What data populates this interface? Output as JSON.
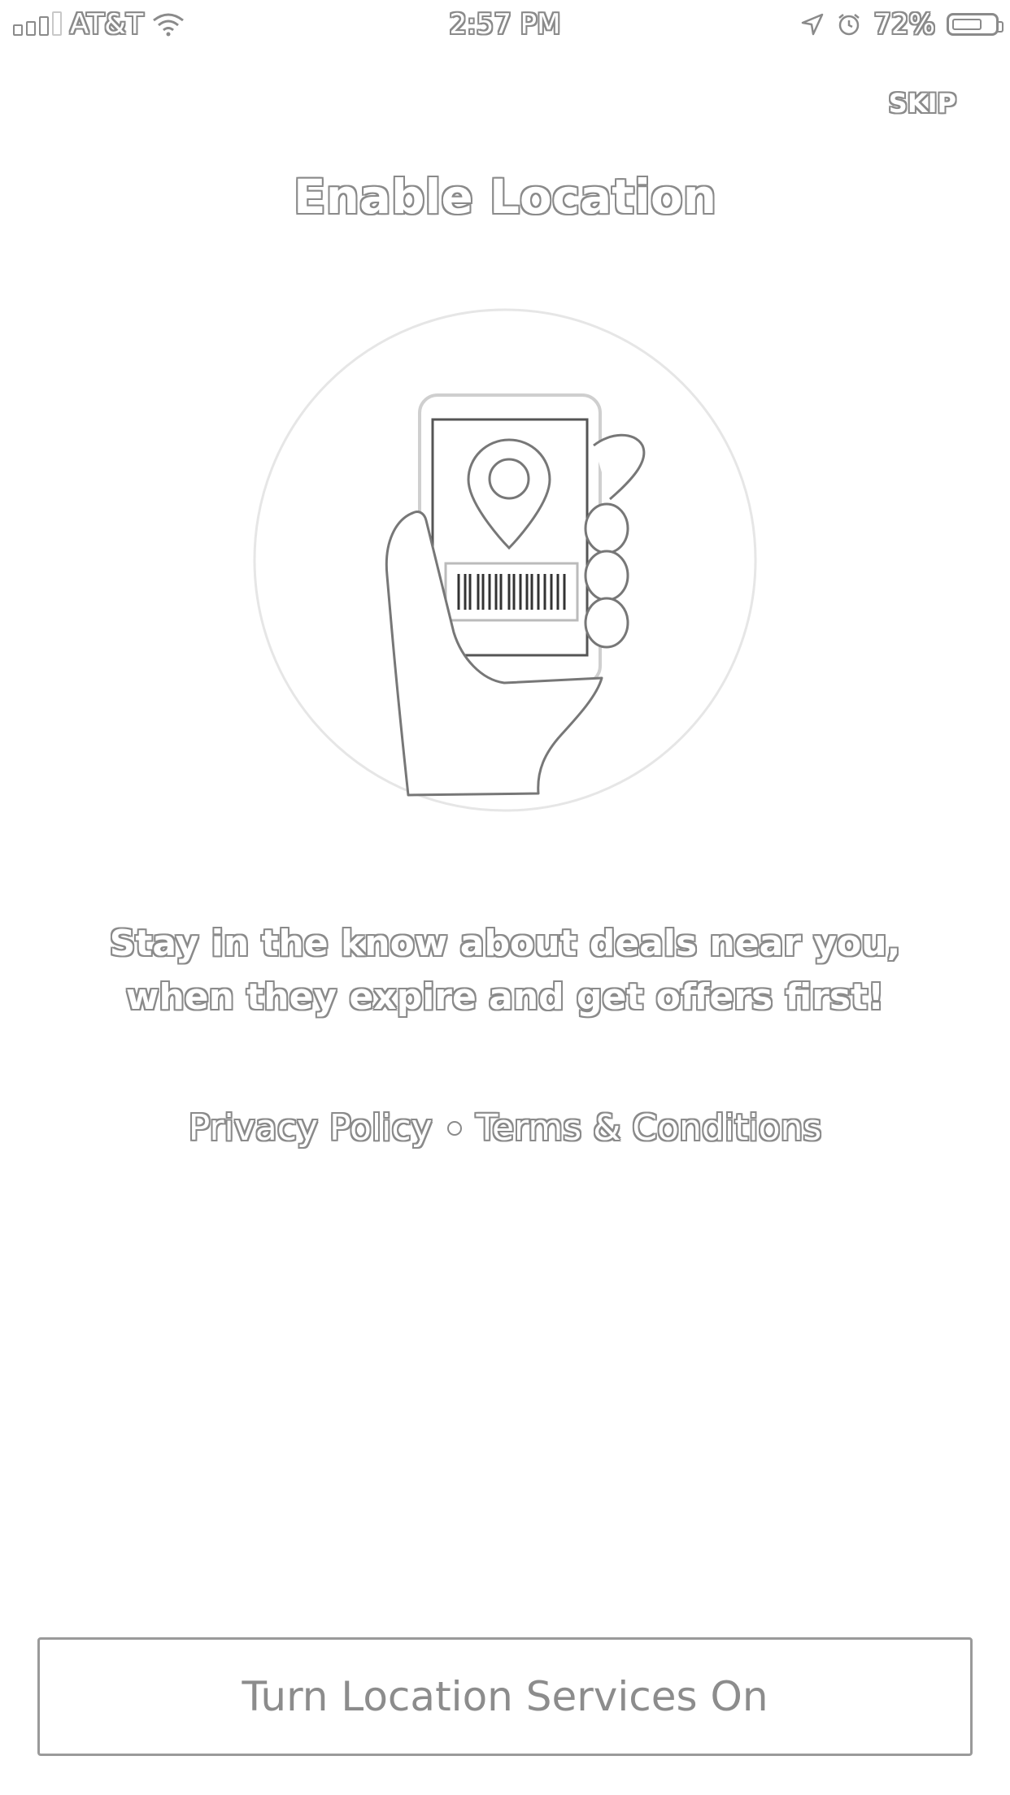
{
  "status_bar": {
    "carrier": "AT&T",
    "time": "2:57 PM",
    "battery_percent": "72%",
    "battery_level": 0.72,
    "icons": [
      "signal-icon",
      "wifi-icon",
      "location-arrow-icon",
      "alarm-icon",
      "battery-icon"
    ]
  },
  "header": {
    "skip_label": "SKIP"
  },
  "main": {
    "title": "Enable Location",
    "illustration": "hand-holding-phone-with-location-pin-and-barcode",
    "description": "Stay in the know about deals near you, when they expire and get offers first!",
    "privacy_label": "Privacy Policy",
    "terms_label": "Terms & Conditions"
  },
  "footer": {
    "cta_label": "Turn Location Services On"
  },
  "colors": {
    "background": "#ffffff",
    "outline": "#8a8a8a",
    "button_text": "#8c8c8c"
  }
}
